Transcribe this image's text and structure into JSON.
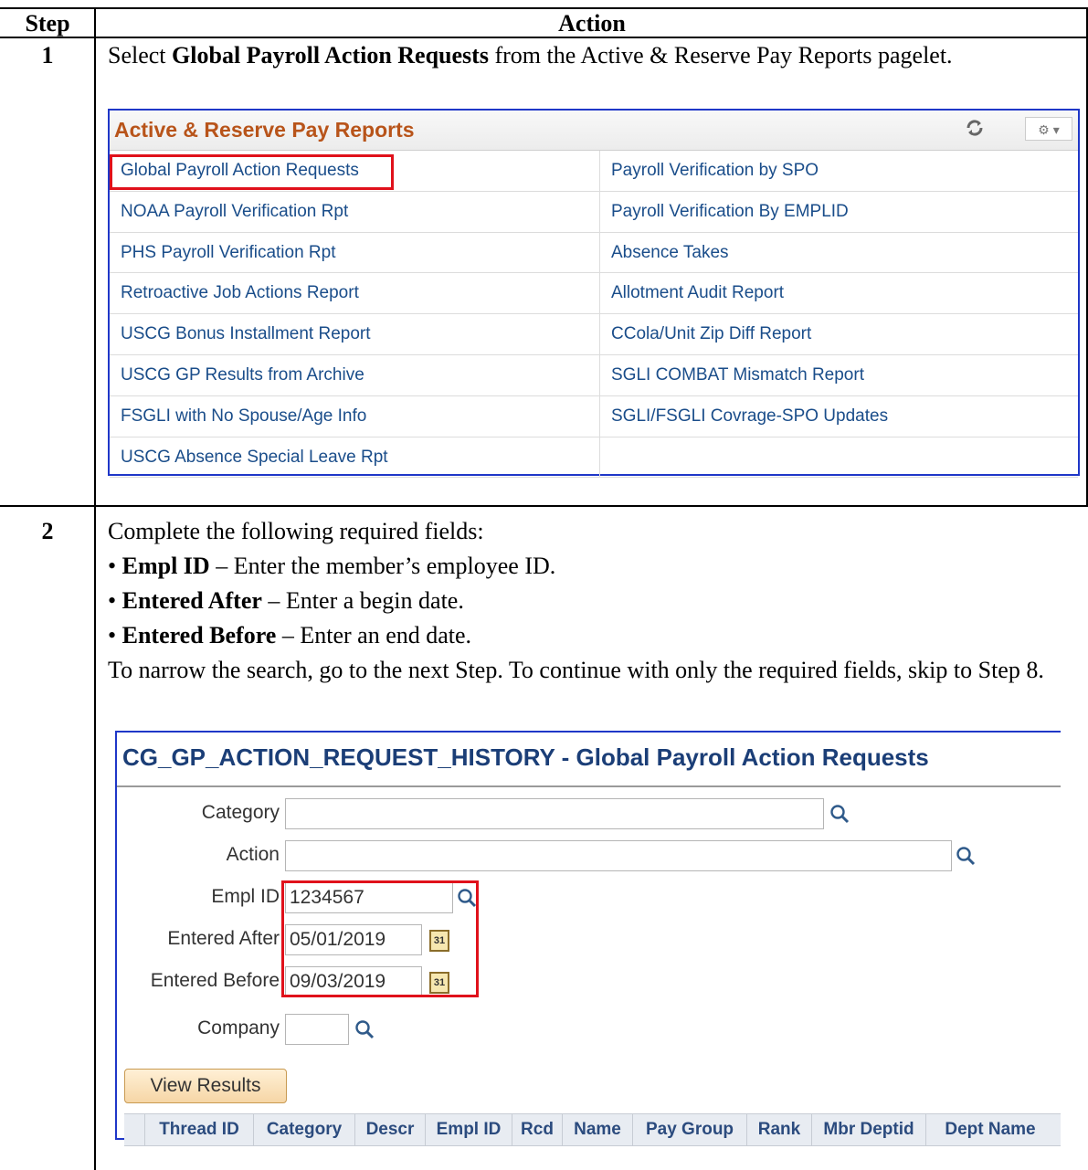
{
  "table": {
    "col_step": "Step",
    "col_action": "Action"
  },
  "step1": {
    "number": "1",
    "text_pre": "Select ",
    "text_bold": "Global Payroll Action Requests",
    "text_post": " from the Active & Reserve Pay Reports pagelet.",
    "pagelet": {
      "title": "Active & Reserve Pay Reports",
      "refresh_icon": "refresh-icon",
      "settings_icon": "gear-icon",
      "settings_glyph": "⚙ ▾",
      "rows": [
        {
          "left": "Global Payroll Action Requests",
          "right": "Payroll Verification by SPO"
        },
        {
          "left": "NOAA Payroll Verification Rpt",
          "right": "Payroll Verification By EMPLID"
        },
        {
          "left": "PHS Payroll Verification Rpt",
          "right": "Absence Takes"
        },
        {
          "left": "Retroactive Job Actions Report",
          "right": "Allotment Audit Report"
        },
        {
          "left": "USCG Bonus Installment Report",
          "right": "CCola/Unit Zip Diff Report"
        },
        {
          "left": "USCG GP Results from Archive",
          "right": "SGLI COMBAT Mismatch Report"
        },
        {
          "left": "FSGLI with No Spouse/Age Info",
          "right": "SGLI/FSGLI Covrage-SPO Updates"
        },
        {
          "left": "USCG Absence Special Leave Rpt",
          "right": ""
        }
      ]
    }
  },
  "step2": {
    "number": "2",
    "intro": "Complete the following required fields:",
    "bullets": [
      {
        "bold": "Empl ID",
        "text": " – Enter the member’s employee ID."
      },
      {
        "bold": "Entered After",
        "text": " – Enter a begin date."
      },
      {
        "bold": "Entered Before",
        "text": " – Enter an end date."
      }
    ],
    "note": "To narrow the search, go to the next Step. To continue with only the required fields, skip to Step 8.",
    "page": {
      "title": "CG_GP_ACTION_REQUEST_HISTORY - Global Payroll Action Requests",
      "fields": {
        "category_label": "Category",
        "category_value": "",
        "action_label": "Action",
        "action_value": "",
        "emplid_label": "Empl ID",
        "emplid_value": "1234567",
        "after_label": "Entered After",
        "after_value": "05/01/2019",
        "before_label": "Entered Before",
        "before_value": "09/03/2019",
        "company_label": "Company",
        "company_value": ""
      },
      "calendar_glyph": "31",
      "view_button": "View Results",
      "grid_columns": [
        "Thread ID",
        "Category",
        "Descr",
        "Empl ID",
        "Rcd",
        "Name",
        "Pay Group",
        "Rank",
        "Mbr Deptid",
        "Dept Name"
      ]
    }
  }
}
